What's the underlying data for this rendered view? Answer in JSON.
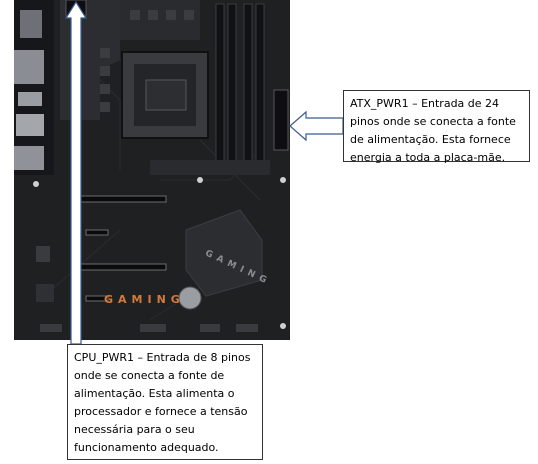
{
  "board": {
    "logo_text": "GAMING",
    "chipset_text": "GAMING"
  },
  "callouts": [
    {
      "id": "atx",
      "text": "ATX_PWR1 – Entrada de 24 pinos onde se conecta a fonte de alimentação. Esta fornece energia a toda a placa-mãe."
    },
    {
      "id": "cpu",
      "text": "CPU_PWR1 – Entrada de 8 pinos onde se conecta a fonte de alimentação. Esta alimenta o processador e fornece a tensão necessária para o seu funcionamento adequado."
    }
  ],
  "colors": {
    "pcb": "#1f2022",
    "heatsink": "#2c2d30",
    "accent": "#d47a3a",
    "arrow_fill": "#ffffff",
    "arrow_stroke": "#3b5b8f"
  }
}
